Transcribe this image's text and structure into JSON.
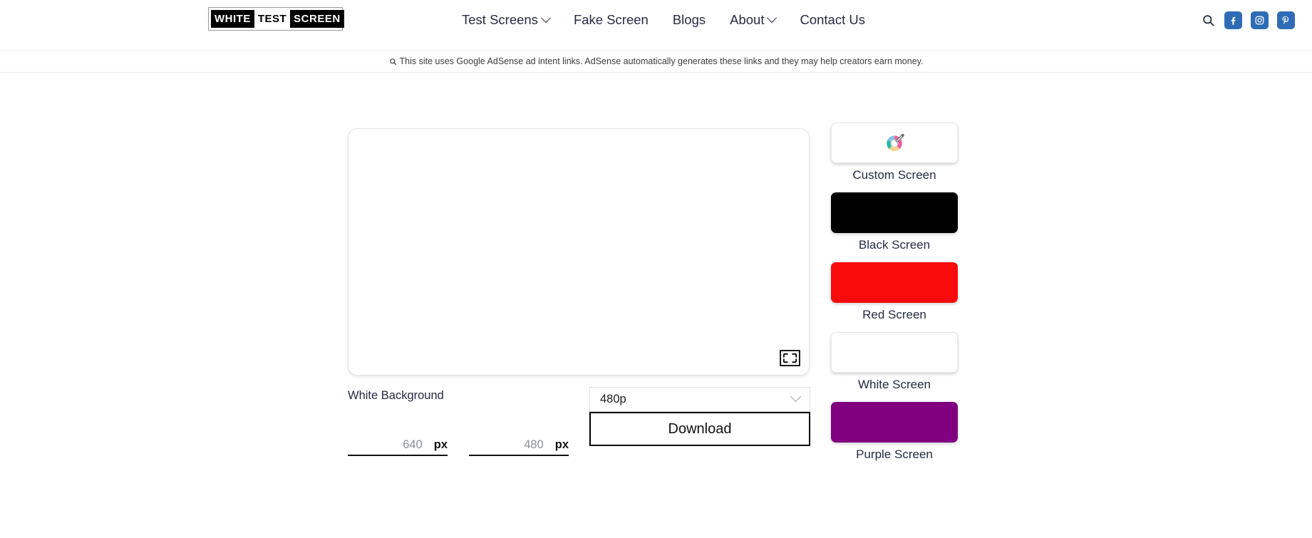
{
  "header": {
    "logo": {
      "segments": [
        {
          "text": "WHITE",
          "style": "dark"
        },
        {
          "text": "TEST",
          "style": "light"
        },
        {
          "text": "SCREEN",
          "style": "dark"
        }
      ]
    },
    "nav": [
      {
        "label": "Test Screens",
        "has_caret": true
      },
      {
        "label": "Fake Screen",
        "has_caret": false
      },
      {
        "label": "Blogs",
        "has_caret": false
      },
      {
        "label": "About",
        "has_caret": true
      },
      {
        "label": "Contact Us",
        "has_caret": false
      }
    ],
    "search_icon": "search-icon",
    "social": [
      {
        "name": "facebook-icon",
        "label": "Facebook"
      },
      {
        "name": "instagram-icon",
        "label": "Instagram"
      },
      {
        "name": "pinterest-icon",
        "label": "Pinterest"
      }
    ],
    "social_bg": "#2f6cb5"
  },
  "notice": {
    "icon": "search-icon",
    "text": "This site uses Google AdSense ad intent links. AdSense automatically generates these links and they may help creators earn money."
  },
  "main": {
    "preview": {
      "background_color": "#ffffff",
      "fullscreen_icon": "fullscreen-icon"
    },
    "background_label": "White Background",
    "width_input": {
      "value": "640",
      "unit": "px",
      "placeholder": "640"
    },
    "height_input": {
      "value": "480",
      "unit": "px",
      "placeholder": "480"
    },
    "resolution_select": {
      "value": "480p"
    },
    "download_button": "Download"
  },
  "sidebar": {
    "cards": [
      {
        "label": "Custom Screen",
        "color": "#ffffff",
        "icon": "color-picker-icon",
        "bordered": true
      },
      {
        "label": "Black Screen",
        "color": "#000000",
        "icon": "",
        "bordered": false
      },
      {
        "label": "Red Screen",
        "color": "#fa0c0c",
        "icon": "",
        "bordered": false
      },
      {
        "label": "White Screen",
        "color": "#ffffff",
        "icon": "",
        "bordered": true
      },
      {
        "label": "Purple Screen",
        "color": "#800080",
        "icon": "",
        "bordered": false
      }
    ]
  }
}
